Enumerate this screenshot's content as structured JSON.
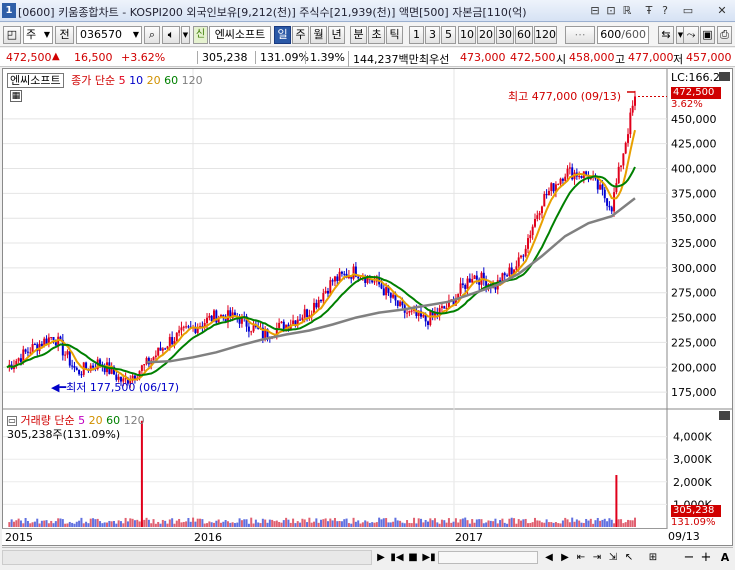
{
  "window": {
    "index": "1",
    "title": "[0600] 키움종합차트 - KOSPI200 외국인보유[9,212(천)] 주식수[21,939(천)] 액면[500] 자본금[110(억)",
    "buttons": [
      "⊟",
      "⊡",
      "ℝ",
      "Ŧ",
      "?",
      "▭",
      "✕"
    ]
  },
  "toolbar": {
    "period_selector": "주",
    "prev_button": "전",
    "stock_code": "036570",
    "stock_name": "엔씨소프트",
    "badge": "신",
    "intervals": [
      "일",
      "주",
      "월",
      "년",
      "분",
      "초",
      "틱"
    ],
    "selected_interval": "일",
    "minute_options": [
      "1",
      "3",
      "5",
      "10",
      "20",
      "30",
      "60",
      "120"
    ],
    "count_value": "600",
    "count_total": "/600"
  },
  "quote": {
    "price": "472,500",
    "change_arrow": "▲",
    "change": "16,500",
    "change_pct": "+3.62%",
    "volume": "305,238",
    "volume_ratio": "131.09%",
    "turnover": "1.39%",
    "amount": "144,237백만",
    "best_ask_label": "최우선",
    "best_ask": "473,000",
    "best_bid": "472,500",
    "open_label": "시",
    "open": "458,000",
    "high_label": "고",
    "high": "477,000",
    "low_label": "저",
    "low": "457,000"
  },
  "price_panel": {
    "legend_name": "엔씨소프트",
    "ma_label": "종가 단순",
    "ma_periods": [
      "5",
      "10",
      "20",
      "60",
      "120"
    ],
    "ma_colors": [
      "#e0001b",
      "#0000c8",
      "#e8a000",
      "#008000",
      "#808080"
    ],
    "lc_label": "LC:166.20",
    "current_price_tag": "472,500",
    "current_pct_tag": "3.62%",
    "high_annotation": "최고 477,000 (09/13)",
    "low_annotation": "최저 177,500 (06/17)",
    "y_ticks": [
      "450,000",
      "425,000",
      "400,000",
      "375,000",
      "350,000",
      "325,000",
      "300,000",
      "275,000",
      "250,000",
      "225,000",
      "200,000",
      "175,000"
    ]
  },
  "volume_panel": {
    "label": "거래량 단순",
    "ma_periods": [
      "5",
      "20",
      "60",
      "120"
    ],
    "ma_colors": [
      "#c000c0",
      "#e8a000",
      "#008000",
      "#808080"
    ],
    "current_value": "305,238주(131.09%)",
    "y_ticks": [
      "4,000K",
      "3,000K",
      "2,000K",
      "1,000K"
    ],
    "current_tag": "305,238",
    "current_pct_tag": "131.09%"
  },
  "x_axis": {
    "labels": [
      "2015",
      "2016",
      "2017"
    ],
    "right_label": "09/13"
  },
  "chart_data": {
    "type": "line",
    "title": "엔씨소프트",
    "y_range": [
      160000,
      480000
    ],
    "x": [
      "2015-06",
      "2015-07",
      "2015-08",
      "2015-09",
      "2015-10",
      "2015-11",
      "2015-12",
      "2016-01",
      "2016-02",
      "2016-03",
      "2016-04",
      "2016-05",
      "2016-06",
      "2016-07",
      "2016-08",
      "2016-09",
      "2016-10",
      "2016-11",
      "2016-12",
      "2017-01",
      "2017-02",
      "2017-03",
      "2017-04",
      "2017-05",
      "2017-06",
      "2017-07",
      "2017-08",
      "2017-09"
    ],
    "series": [
      {
        "name": "5",
        "values": [
          200000,
          218000,
          232000,
          195000,
          205000,
          185000,
          203000,
          227000,
          240000,
          252000,
          249000,
          233000,
          243000,
          257000,
          287000,
          297000,
          283000,
          257000,
          247000,
          262000,
          293000,
          282000,
          305000,
          368000,
          397000,
          393000,
          362000,
          472500
        ]
      },
      {
        "name": "120",
        "values": [
          null,
          null,
          null,
          null,
          null,
          null,
          205000,
          206000,
          210000,
          215000,
          222000,
          228000,
          233000,
          237000,
          243000,
          250000,
          255000,
          258000,
          262000,
          266000,
          274000,
          282000,
          294000,
          312000,
          332000,
          345000,
          352000,
          370000
        ]
      }
    ],
    "volume": {
      "spike_value": 4700000,
      "late_spike": 2300000,
      "typical": 350000
    },
    "annotations": [
      {
        "label": "최고",
        "value": 477000,
        "date": "09/13"
      },
      {
        "label": "최저",
        "value": 177500,
        "date": "06/17"
      }
    ]
  }
}
